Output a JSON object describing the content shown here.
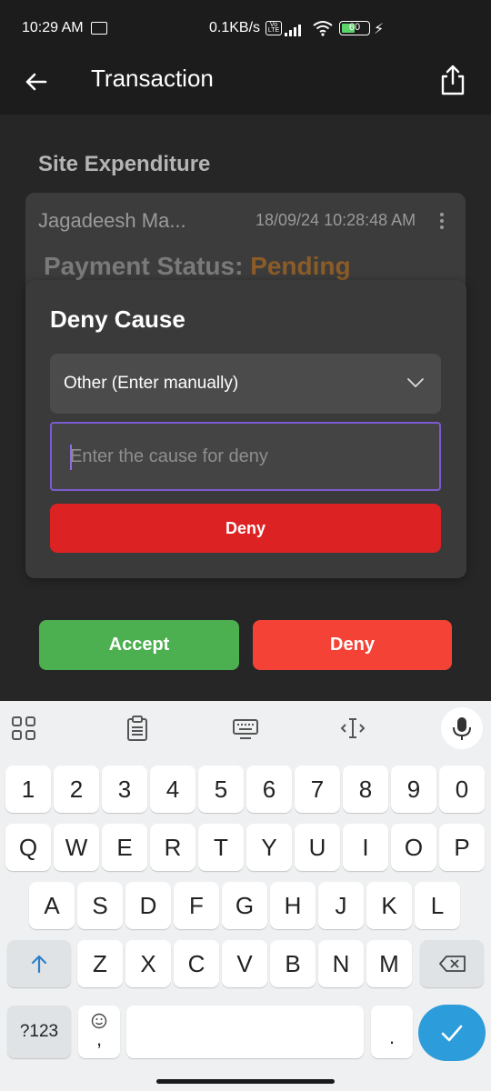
{
  "status_bar": {
    "time": "10:29 AM",
    "network_speed": "0.1KB/s",
    "volte_badge": "Vo LTE",
    "battery": "60"
  },
  "app_bar": {
    "title": "Transaction"
  },
  "content": {
    "section_title": "Site Expenditure",
    "card": {
      "person": "Jagadeesh Ma...",
      "datetime": "18/09/24 10:28:48 AM",
      "payment_status_label": "Payment Status:",
      "payment_status_value": "Pending"
    }
  },
  "dialog": {
    "title": "Deny Cause",
    "selected_cause": "Other (Enter manually)",
    "cause_placeholder": "Enter the cause for deny",
    "deny_label": "Deny"
  },
  "actions": {
    "accept_label": "Accept",
    "deny_label": "Deny"
  },
  "keyboard": {
    "number_row": [
      "1",
      "2",
      "3",
      "4",
      "5",
      "6",
      "7",
      "8",
      "9",
      "0"
    ],
    "row1": [
      "Q",
      "W",
      "E",
      "R",
      "T",
      "Y",
      "U",
      "I",
      "O",
      "P"
    ],
    "row2": [
      "A",
      "S",
      "D",
      "F",
      "G",
      "H",
      "J",
      "K",
      "L"
    ],
    "row3": [
      "Z",
      "X",
      "C",
      "V",
      "B",
      "N",
      "M"
    ],
    "symbols_label": "?123",
    "comma": ",",
    "period": "."
  },
  "colors": {
    "accept": "#4caf50",
    "deny": "#f44336",
    "dialog_deny": "#dc2222",
    "pending": "#8c5c27",
    "input_focus": "#7b5bd0",
    "enter_key": "#2d9cdb"
  }
}
